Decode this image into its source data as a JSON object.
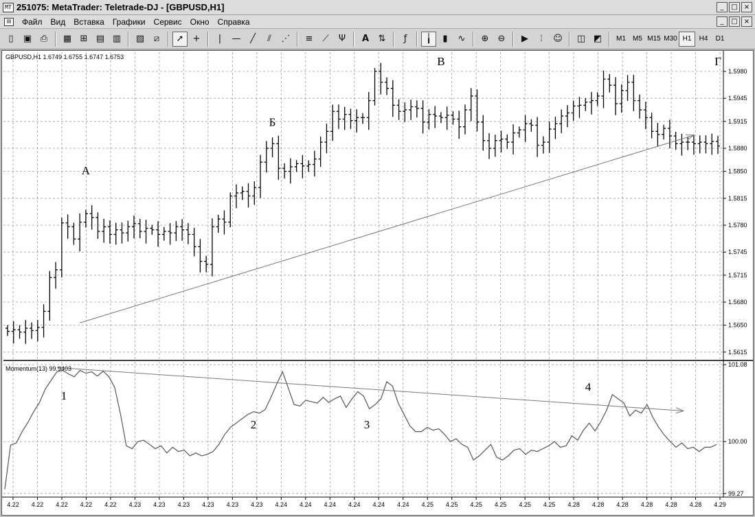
{
  "window": {
    "title": "251075: MetaTrader: Teletrade-DJ - [GBPUSD,H1]",
    "icon_label": "MT",
    "buttons": [
      "minimize-icon",
      "restore-icon",
      "close-icon"
    ]
  },
  "menu": {
    "items": [
      "Файл",
      "Вид",
      "Вставка",
      "Графики",
      "Сервис",
      "Окно",
      "Справка"
    ]
  },
  "toolbar": {
    "timeframes": [
      "M1",
      "M5",
      "M15",
      "M30",
      "H1",
      "H4",
      "D1"
    ],
    "active_timeframe": "H1",
    "text_tool_label": "A"
  },
  "price_chart": {
    "header": "GBPUSD,H1  1.6749 1.6755 1.6747 1.6753",
    "y_ticks": [
      "1.5980",
      "1.5945",
      "1.5915",
      "1.5880",
      "1.5850",
      "1.5815",
      "1.5780",
      "1.5745",
      "1.5715",
      "1.5680",
      "1.5650",
      "1.5615"
    ],
    "annotations": [
      "А",
      "Б",
      "В",
      "Г"
    ]
  },
  "indicator": {
    "header": "Momentum(13) 99.9403",
    "y_ticks": [
      "101.08",
      "100.00",
      "99.27"
    ],
    "annotations": [
      "1",
      "2",
      "3",
      "4"
    ]
  },
  "x_ticks": [
    "4.22",
    "4.22",
    "4.22",
    "4.22",
    "4.22",
    "4.23",
    "4.23",
    "4.23",
    "4.23",
    "4.23",
    "4.23",
    "4.24",
    "4.24",
    "4.24",
    "4.24",
    "4.24",
    "4.24",
    "4.25",
    "4.25",
    "4.25",
    "4.25",
    "4.25",
    "4.25",
    "4.28",
    "4.28",
    "4.28",
    "4.28",
    "4.28",
    "4.28",
    "4.29"
  ],
  "chart_data": [
    {
      "type": "bar",
      "title": "GBPUSD,H1",
      "ohlc_header": "1.6749 1.6755 1.6747 1.6753",
      "ylim": [
        1.5605,
        1.6005
      ],
      "y_ticks": [
        1.598,
        1.5945,
        1.5915,
        1.588,
        1.585,
        1.5815,
        1.578,
        1.5745,
        1.5715,
        1.568,
        1.565,
        1.5615
      ],
      "closes": [
        1.5642,
        1.5644,
        1.5641,
        1.5646,
        1.5643,
        1.5647,
        1.5668,
        1.5712,
        1.5722,
        1.5783,
        1.5778,
        1.5762,
        1.5784,
        1.5795,
        1.579,
        1.5772,
        1.5778,
        1.5768,
        1.5774,
        1.577,
        1.5778,
        1.5782,
        1.5772,
        1.5776,
        1.5774,
        1.5768,
        1.5772,
        1.577,
        1.5778,
        1.5774,
        1.5768,
        1.5752,
        1.5733,
        1.5729,
        1.5778,
        1.5788,
        1.5784,
        1.5818,
        1.5822,
        1.5824,
        1.5818,
        1.5829,
        1.5862,
        1.588,
        1.5886,
        1.5854,
        1.585,
        1.5856,
        1.586,
        1.5857,
        1.5859,
        1.5866,
        1.5888,
        1.5902,
        1.5928,
        1.5918,
        1.5924,
        1.5916,
        1.592,
        1.592,
        1.5942,
        1.598,
        1.5966,
        1.5958,
        1.5936,
        1.5928,
        1.593,
        1.5934,
        1.5932,
        1.5914,
        1.5924,
        1.5922,
        1.592,
        1.5923,
        1.5918,
        1.5908,
        1.593,
        1.5948,
        1.5914,
        1.589,
        1.588,
        1.589,
        1.5892,
        1.5888,
        1.59,
        1.5904,
        1.5912,
        1.591,
        1.5884,
        1.5888,
        1.5905,
        1.5912,
        1.5922,
        1.5926,
        1.5935,
        1.5936,
        1.594,
        1.5942,
        1.5948,
        1.597,
        1.5962,
        1.5938,
        1.5955,
        1.5966,
        1.5942,
        1.593,
        1.592,
        1.5902,
        1.5898,
        1.5906,
        1.5896,
        1.5886,
        1.5888,
        1.5888,
        1.5886,
        1.5888,
        1.5886,
        1.5889,
        1.5883
      ],
      "trend_line": {
        "from": {
          "bar": 12,
          "price": 1.5653
        },
        "to": {
          "bar": 114,
          "price": 1.5897
        }
      },
      "annotations": [
        {
          "label": "А",
          "bar": 13,
          "price": 1.5846
        },
        {
          "label": "Б",
          "bar": 44,
          "price": 1.5909
        },
        {
          "label": "В",
          "bar": 72,
          "price": 1.5988
        },
        {
          "label": "Г",
          "bar": 118,
          "price": 1.5988
        }
      ]
    },
    {
      "type": "line",
      "title": "Momentum(13)",
      "last_value": 99.9403,
      "ylim": [
        99.22,
        101.12
      ],
      "y_ticks": [
        101.08,
        100.0,
        99.27
      ],
      "values": [
        99.33,
        99.95,
        99.98,
        100.14,
        100.27,
        100.42,
        100.55,
        100.74,
        100.86,
        100.98,
        101.0,
        100.95,
        100.91,
        101.0,
        100.96,
        100.98,
        100.92,
        100.99,
        100.91,
        100.76,
        100.38,
        99.94,
        99.9,
        100.0,
        100.02,
        99.96,
        99.9,
        99.94,
        99.84,
        99.92,
        99.86,
        99.88,
        99.8,
        99.84,
        99.8,
        99.82,
        99.86,
        99.96,
        100.1,
        100.2,
        100.26,
        100.32,
        100.38,
        100.42,
        100.4,
        100.45,
        100.62,
        100.81,
        100.98,
        100.75,
        100.52,
        100.5,
        100.58,
        100.56,
        100.54,
        100.62,
        100.55,
        100.6,
        100.64,
        100.48,
        100.6,
        100.7,
        100.64,
        100.46,
        100.52,
        100.6,
        100.84,
        100.78,
        100.54,
        100.38,
        100.22,
        100.14,
        100.14,
        100.2,
        100.16,
        100.18,
        100.1,
        100.0,
        100.04,
        99.96,
        99.92,
        99.74,
        99.8,
        99.88,
        99.96,
        99.78,
        99.74,
        99.8,
        99.88,
        99.9,
        99.82,
        99.88,
        99.86,
        99.9,
        99.94,
        100.0,
        99.92,
        99.94,
        100.08,
        100.02,
        100.16,
        100.26,
        100.15,
        100.28,
        100.44,
        100.66,
        100.6,
        100.54,
        100.36,
        100.44,
        100.4,
        100.52,
        100.34,
        100.2,
        100.09,
        100.0,
        99.92,
        99.98,
        99.9,
        99.92,
        99.86,
        99.92,
        99.92,
        99.96
      ]
    }
  ]
}
